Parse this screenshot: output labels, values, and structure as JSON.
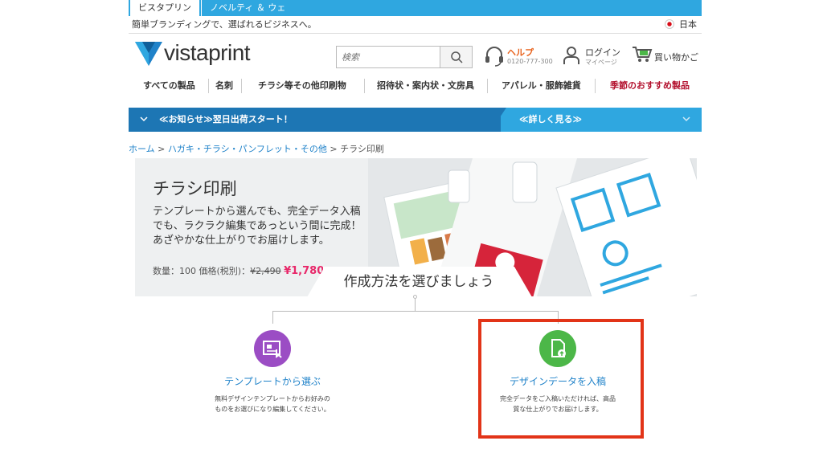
{
  "top_tabs": {
    "active": "ビスタプリント",
    "inactive": "ノベルティ ＆ ウェア"
  },
  "tagline": "簡単ブランディングで、選ばれるビジネスへ。",
  "language": "日本",
  "logo_text": "vistaprint",
  "search": {
    "placeholder": "検索"
  },
  "help": {
    "label": "ヘルプ",
    "phone": "0120-777-300"
  },
  "login": {
    "label": "ログイン",
    "sub": "マイページ"
  },
  "cart": {
    "label": "買い物かご"
  },
  "nav": [
    "すべての製品",
    "名刺",
    "チラシ等その他印刷物",
    "招待状・案内状・文房具",
    "アパレル・服飾雑貨",
    "季節のおすすめ製品"
  ],
  "announcement": {
    "left": "≪お知らせ≫翌日出荷スタート！",
    "right": "≪詳しく見る≫"
  },
  "breadcrumb": {
    "home": "ホーム",
    "sep": " > ",
    "parent": "ハガキ・チラシ・パンフレット・その他",
    "current": "チラシ印刷"
  },
  "hero": {
    "title": "チラシ印刷",
    "desc_1": "テンプレートから選んでも、完全データ入稿",
    "desc_2": "でも、ラクラク編集であっという間に完成！",
    "desc_3": "あざやかな仕上がりでお届けします。",
    "price_label": "数量：100 価格(税別)：",
    "price_old": "¥2,490",
    "price_new": "¥1,780"
  },
  "choose_method": "作成方法を選びましょう",
  "options": [
    {
      "title": "テンプレートから選ぶ",
      "desc_1": "無料デザインテンプレートからお好みの",
      "desc_2": "ものをお選びになり編集してください。",
      "color": "#9b4dc4"
    },
    {
      "title": "デザインデータを入稿",
      "desc_1": "完全データをご入稿いただければ、高品",
      "desc_2": "質な仕上がりでお届けします。",
      "color": "#4cb748"
    }
  ]
}
